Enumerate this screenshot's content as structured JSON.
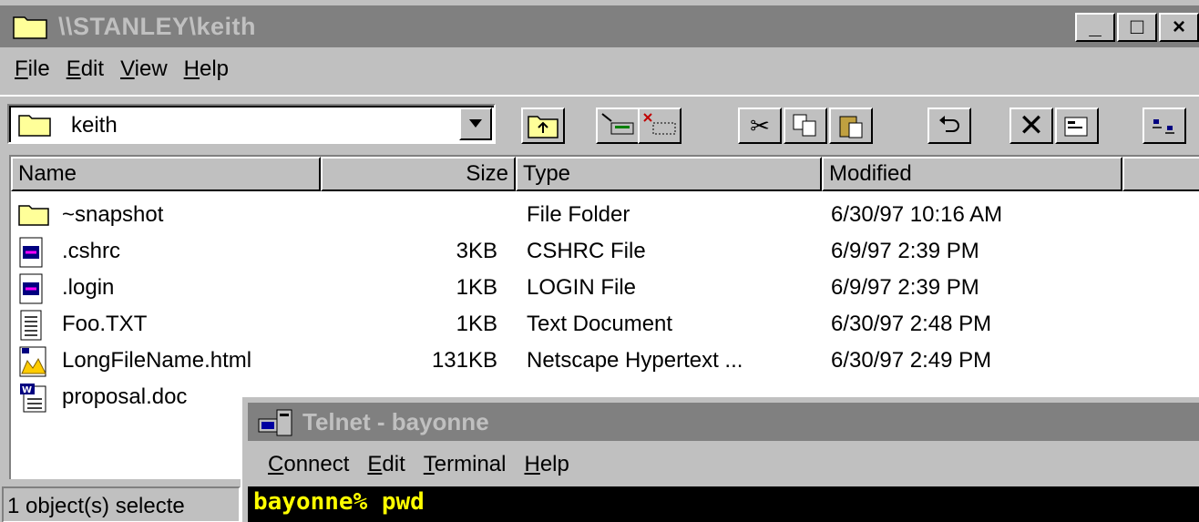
{
  "explorer": {
    "title": "\\\\STANLEY\\keith",
    "window_buttons": [
      "_",
      "□",
      "×"
    ],
    "menu": [
      "File",
      "Edit",
      "View",
      "Help"
    ],
    "address": "keith",
    "toolbar_icons": [
      "up-folder-icon",
      "map-drive-icon",
      "disconnect-drive-icon",
      "cut-icon",
      "copy-icon",
      "paste-icon",
      "undo-icon",
      "delete-icon",
      "properties-icon",
      "large-icons-icon"
    ],
    "columns": [
      "Name",
      "Size",
      "Type",
      "Modified"
    ],
    "rows": [
      {
        "name": "~snapshot",
        "size": "",
        "type": "File Folder",
        "modified": "6/30/97 10:16 AM",
        "icon": "folder-icon"
      },
      {
        "name": ".cshrc",
        "size": "3KB",
        "type": "CSHRC File",
        "modified": "6/9/97 2:39 PM",
        "icon": "file-icon"
      },
      {
        "name": ".login",
        "size": "1KB",
        "type": "LOGIN File",
        "modified": "6/9/97 2:39 PM",
        "icon": "file-icon"
      },
      {
        "name": "Foo.TXT",
        "size": "1KB",
        "type": "Text Document",
        "modified": "6/30/97 2:48 PM",
        "icon": "text-document-icon"
      },
      {
        "name": "LongFileName.html",
        "size": "131KB",
        "type": "Netscape Hypertext ...",
        "modified": "6/30/97 2:49 PM",
        "icon": "html-document-icon"
      },
      {
        "name": "proposal.doc",
        "size": "",
        "type": "",
        "modified": "",
        "icon": "word-document-icon"
      }
    ],
    "status": "1 object(s) selecte"
  },
  "telnet": {
    "title": "Telnet - bayonne",
    "menu": [
      "Connect",
      "Edit",
      "Terminal",
      "Help"
    ],
    "terminal_line": "bayonne% pwd"
  },
  "colors": {
    "title_inactive": "#808080",
    "face": "#c0c0c0",
    "terminal_bg": "#000000",
    "terminal_fg": "#ffff00"
  }
}
